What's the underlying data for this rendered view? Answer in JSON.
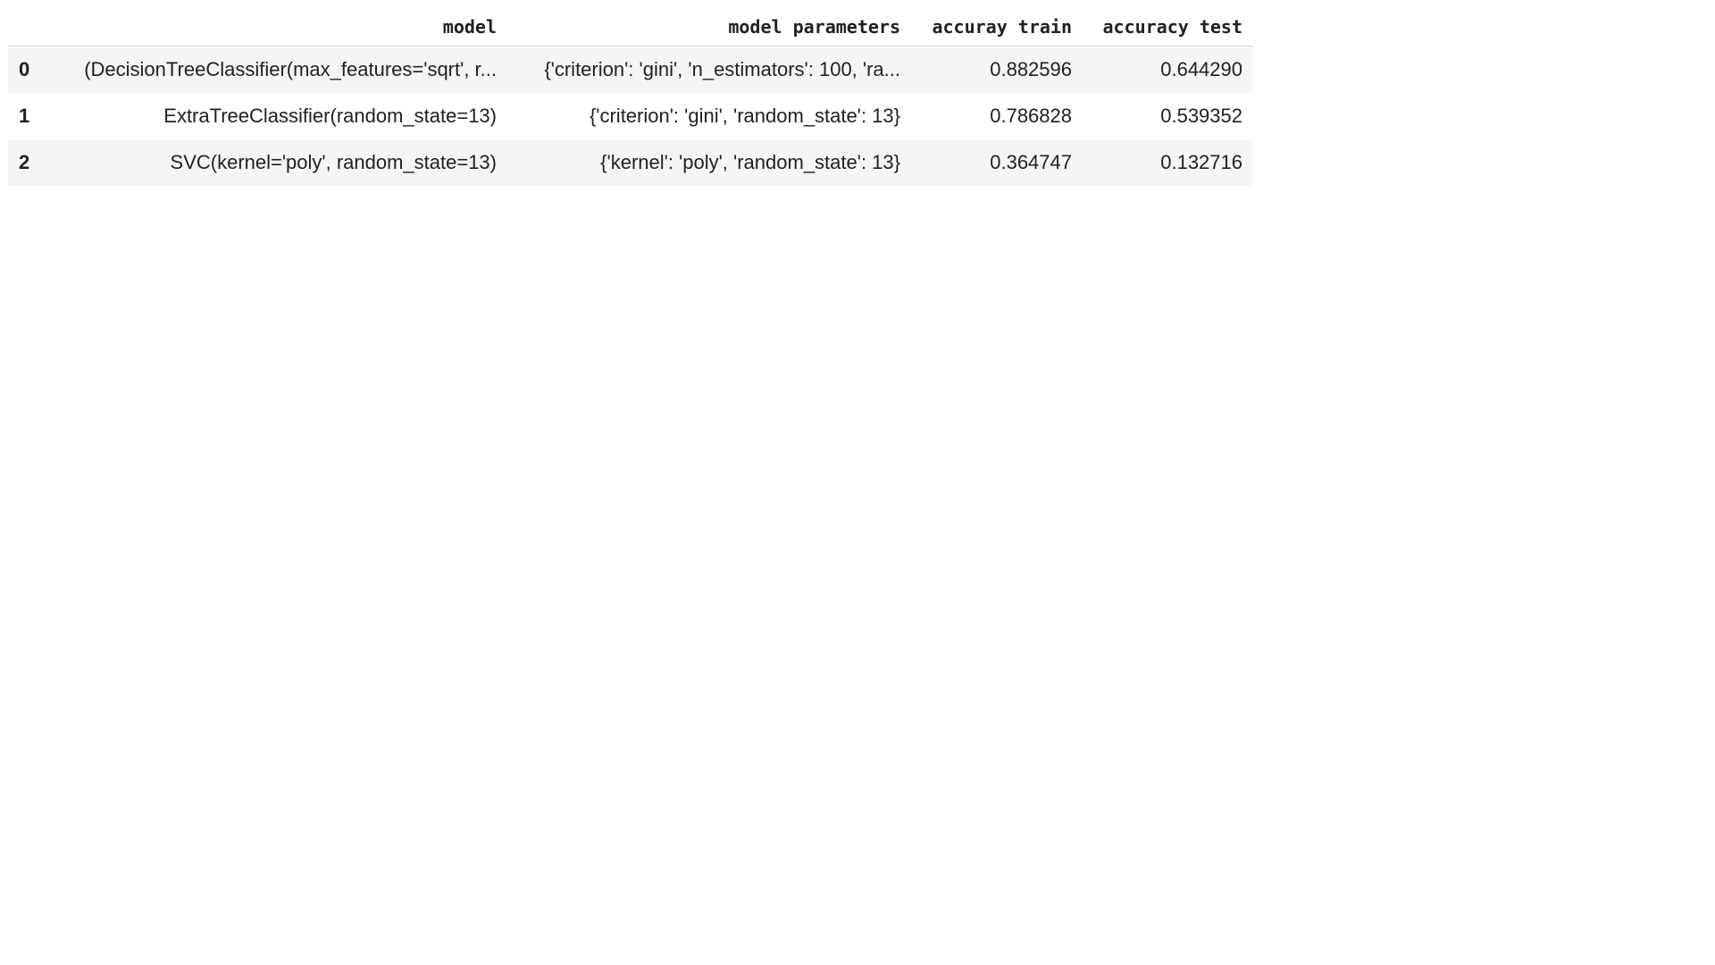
{
  "table": {
    "columns": [
      "model",
      "model parameters",
      "accuray train",
      "accuracy test"
    ],
    "rows": [
      {
        "index": "0",
        "model": "(DecisionTreeClassifier(max_features='sqrt', r...",
        "params": "{'criterion': 'gini', 'n_estimators': 100, 'ra...",
        "train": "0.882596",
        "test": "0.644290"
      },
      {
        "index": "1",
        "model": "ExtraTreeClassifier(random_state=13)",
        "params": "{'criterion': 'gini', 'random_state': 13}",
        "train": "0.786828",
        "test": "0.539352"
      },
      {
        "index": "2",
        "model": "SVC(kernel='poly', random_state=13)",
        "params": "{'kernel': 'poly', 'random_state': 13}",
        "train": "0.364747",
        "test": "0.132716"
      }
    ]
  }
}
